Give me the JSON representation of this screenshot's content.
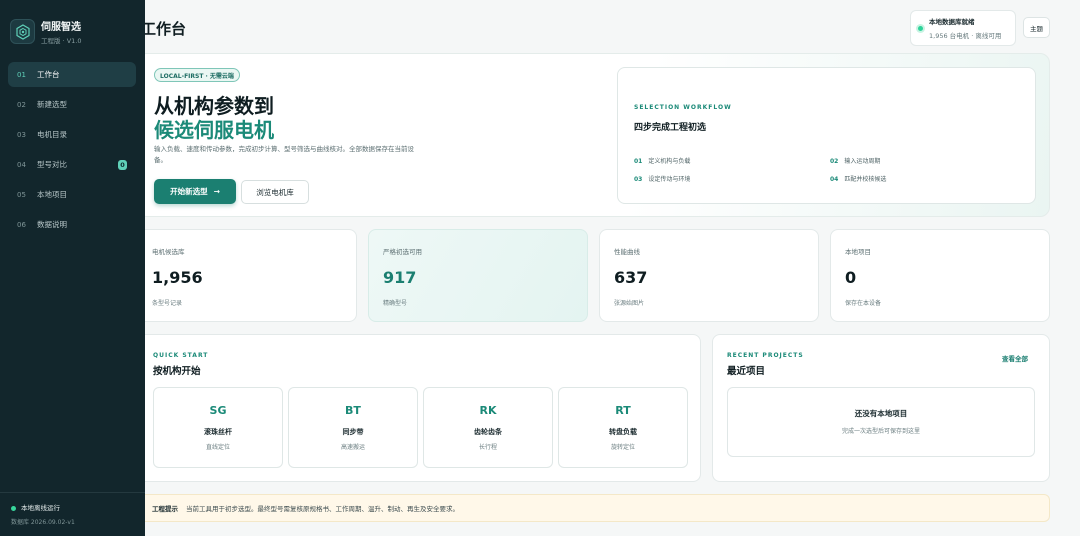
{
  "brand": {
    "name": "伺服智选",
    "version": "工程版 · V1.0"
  },
  "nav": [
    {
      "num": "01",
      "label": "工作台",
      "active": true
    },
    {
      "num": "02",
      "label": "新建选型"
    },
    {
      "num": "03",
      "label": "电机目录"
    },
    {
      "num": "04",
      "label": "型号对比",
      "badge": "0"
    },
    {
      "num": "05",
      "label": "本地项目"
    },
    {
      "num": "06",
      "label": "数据说明"
    }
  ],
  "sidebar_footer": {
    "status": "本地离线运行",
    "db": "数据库 2026.09.02-v1"
  },
  "header": {
    "title": "工作台",
    "status_title": "本地数据库就绪",
    "status_sub": "1,956 台电机 · 离线可用",
    "theme_label": "主题"
  },
  "hero": {
    "badge": "LOCAL-FIRST · 无需云端",
    "title_line1": "从机构参数到",
    "title_line2": "候选伺服电机",
    "description": "输入负载、速度和传动参数，完成初步计算、型号筛选与曲线核对。全部数据保存在当前设备。",
    "primary_label": "开始新选型",
    "primary_arrow": "→",
    "secondary_label": "浏览电机库"
  },
  "workflow": {
    "eyebrow": "SELECTION WORKFLOW",
    "title": "四步完成工程初选",
    "steps": [
      {
        "num": "01",
        "label": "定义机构与负载"
      },
      {
        "num": "02",
        "label": "输入运动周期"
      },
      {
        "num": "03",
        "label": "设定传动与环境"
      },
      {
        "num": "04",
        "label": "匹配并校核候选"
      }
    ]
  },
  "stats": [
    {
      "label": "电机候选库",
      "value": "1,956",
      "sub": "条型号记录"
    },
    {
      "label": "严格初选可用",
      "value": "917",
      "sub": "精确型号"
    },
    {
      "label": "性能曲线",
      "value": "637",
      "sub": "张源始图片"
    },
    {
      "label": "本地项目",
      "value": "0",
      "sub": "保存在本设备"
    }
  ],
  "quick_start": {
    "eyebrow": "QUICK START",
    "title": "按机构开始",
    "cards": [
      {
        "code": "SG",
        "name": "滚珠丝杆",
        "desc": "直线定位"
      },
      {
        "code": "BT",
        "name": "同步带",
        "desc": "高速搬运"
      },
      {
        "code": "RK",
        "name": "齿轮齿条",
        "desc": "长行程"
      },
      {
        "code": "RT",
        "name": "转盘负载",
        "desc": "旋转定位"
      }
    ]
  },
  "recent": {
    "eyebrow": "RECENT PROJECTS",
    "title": "最近项目",
    "view_all": "查看全部",
    "empty_title": "还没有本地项目",
    "empty_sub": "完成一次选型后可保存到这里"
  },
  "tip": {
    "label": "工程提示",
    "text": "当前工具用于初步选型。最终型号需复核原规格书、工作周期、温升、制动、再生及安全要求。"
  },
  "colors": {
    "accent": "#1b7f71",
    "sidebar": "#12262c",
    "tip_bg": "#fff8e9"
  }
}
